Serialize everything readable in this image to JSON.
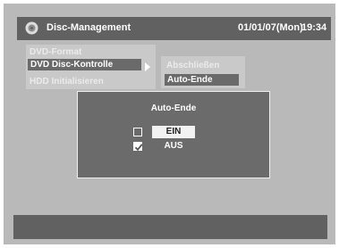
{
  "header": {
    "icon": "disc-icon",
    "title": "Disc-Management",
    "date": "01/01/07(Mon)",
    "time": "19:34"
  },
  "menu": {
    "items": [
      {
        "label": "DVD-Format",
        "state": "disabled"
      },
      {
        "label": "DVD Disc-Kontrolle",
        "state": "selected"
      },
      {
        "label": "HDD Initialisieren",
        "state": "disabled"
      }
    ]
  },
  "submenu": {
    "items": [
      {
        "label": "Abschließen",
        "state": "disabled"
      },
      {
        "label": "Auto-Ende",
        "state": "selected"
      }
    ]
  },
  "dialog": {
    "title": "Auto-Ende",
    "options": [
      {
        "label": "EIN",
        "checked": false,
        "highlighted": true
      },
      {
        "label": "AUS",
        "checked": true,
        "highlighted": false
      }
    ]
  },
  "colors": {
    "background": "#b9b9b9",
    "bar": "#616161",
    "panel": "#c9c9c9",
    "highlight": "#6a6a6a",
    "dialog": "#6b6b6b"
  }
}
